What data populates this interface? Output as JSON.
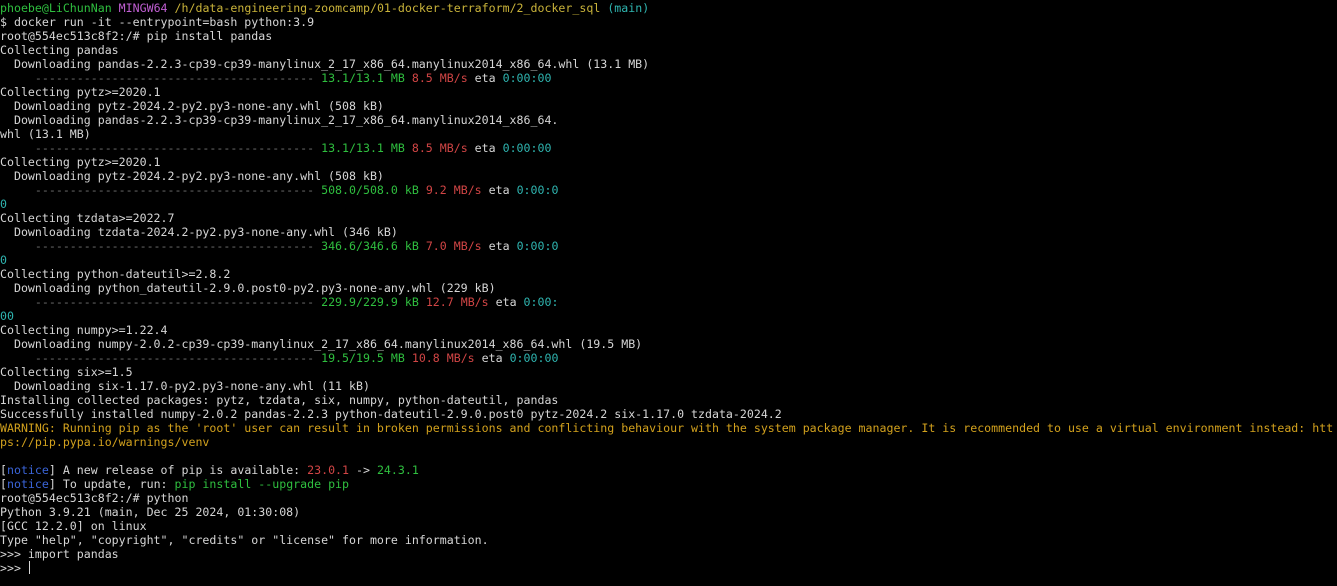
{
  "colors": {
    "default": "#d6d6d6",
    "green": "#2fbf3f",
    "purple": "#c15fd3",
    "yellow": "#c9b33a",
    "cyan": "#2fb5b0",
    "red": "#d14545",
    "bar_gray": "#6f6f6f",
    "blue": "#3a64d8",
    "warning": "#d2a11d"
  },
  "terminal": {
    "lines": [
      [
        {
          "t": "phoebe@LiChunNan",
          "c": "green"
        },
        {
          "t": " ",
          "c": "default"
        },
        {
          "t": "MINGW64",
          "c": "purple"
        },
        {
          "t": " ",
          "c": "default"
        },
        {
          "t": "/h/data-engineering-zoomcamp/01-docker-terraform/2_docker_sql",
          "c": "yellow"
        },
        {
          "t": " ",
          "c": "default"
        },
        {
          "t": "(main)",
          "c": "cyan"
        }
      ],
      [
        {
          "t": "$ docker run -it --entrypoint=bash python:3.9",
          "c": "default"
        }
      ],
      [
        {
          "t": "root@554ec513c8f2:/# pip install pandas",
          "c": "default"
        }
      ],
      [
        {
          "t": "Collecting pandas",
          "c": "default"
        }
      ],
      [
        {
          "t": "  Downloading pandas-2.2.3-cp39-cp39-manylinux_2_17_x86_64.manylinux2014_x86_64.whl (13.1 MB)",
          "c": "default"
        }
      ],
      [
        {
          "t": "     ---------------------------------------- ",
          "c": "bar_gray"
        },
        {
          "t": "13.1/13.1 MB",
          "c": "green"
        },
        {
          "t": " ",
          "c": "default"
        },
        {
          "t": "8.5 MB/s",
          "c": "red"
        },
        {
          "t": " eta ",
          "c": "default"
        },
        {
          "t": "0:00:00",
          "c": "cyan"
        }
      ],
      [
        {
          "t": "Collecting pytz>=2020.1",
          "c": "default"
        }
      ],
      [
        {
          "t": "  Downloading pytz-2024.2-py2.py3-none-any.whl (508 kB)",
          "c": "default"
        }
      ],
      [
        {
          "t": "  Downloading pandas-2.2.3-cp39-cp39-manylinux_2_17_x86_64.manylinux2014_x86_64.",
          "c": "default"
        }
      ],
      [
        {
          "t": "whl (13.1 MB)",
          "c": "default"
        }
      ],
      [
        {
          "t": "     ---------------------------------------- ",
          "c": "bar_gray"
        },
        {
          "t": "13.1/13.1 MB",
          "c": "green"
        },
        {
          "t": " ",
          "c": "default"
        },
        {
          "t": "8.5 MB/s",
          "c": "red"
        },
        {
          "t": " eta ",
          "c": "default"
        },
        {
          "t": "0:00:00",
          "c": "cyan"
        }
      ],
      [
        {
          "t": "Collecting pytz>=2020.1",
          "c": "default"
        }
      ],
      [
        {
          "t": "  Downloading pytz-2024.2-py2.py3-none-any.whl (508 kB)",
          "c": "default"
        }
      ],
      [
        {
          "t": "     ---------------------------------------- ",
          "c": "bar_gray"
        },
        {
          "t": "508.0/508.0 kB",
          "c": "green"
        },
        {
          "t": " ",
          "c": "default"
        },
        {
          "t": "9.2 MB/s",
          "c": "red"
        },
        {
          "t": " eta ",
          "c": "default"
        },
        {
          "t": "0:00:0",
          "c": "cyan"
        }
      ],
      [
        {
          "t": "0",
          "c": "cyan"
        }
      ],
      [
        {
          "t": "Collecting tzdata>=2022.7",
          "c": "default"
        }
      ],
      [
        {
          "t": "  Downloading tzdata-2024.2-py2.py3-none-any.whl (346 kB)",
          "c": "default"
        }
      ],
      [
        {
          "t": "     ---------------------------------------- ",
          "c": "bar_gray"
        },
        {
          "t": "346.6/346.6 kB",
          "c": "green"
        },
        {
          "t": " ",
          "c": "default"
        },
        {
          "t": "7.0 MB/s",
          "c": "red"
        },
        {
          "t": " eta ",
          "c": "default"
        },
        {
          "t": "0:00:0",
          "c": "cyan"
        }
      ],
      [
        {
          "t": "0",
          "c": "cyan"
        }
      ],
      [
        {
          "t": "Collecting python-dateutil>=2.8.2",
          "c": "default"
        }
      ],
      [
        {
          "t": "  Downloading python_dateutil-2.9.0.post0-py2.py3-none-any.whl (229 kB)",
          "c": "default"
        }
      ],
      [
        {
          "t": "     ---------------------------------------- ",
          "c": "bar_gray"
        },
        {
          "t": "229.9/229.9 kB",
          "c": "green"
        },
        {
          "t": " ",
          "c": "default"
        },
        {
          "t": "12.7 MB/s",
          "c": "red"
        },
        {
          "t": " eta ",
          "c": "default"
        },
        {
          "t": "0:00:",
          "c": "cyan"
        }
      ],
      [
        {
          "t": "00",
          "c": "cyan"
        }
      ],
      [
        {
          "t": "Collecting numpy>=1.22.4",
          "c": "default"
        }
      ],
      [
        {
          "t": "  Downloading numpy-2.0.2-cp39-cp39-manylinux_2_17_x86_64.manylinux2014_x86_64.whl (19.5 MB)",
          "c": "default"
        }
      ],
      [
        {
          "t": "     ---------------------------------------- ",
          "c": "bar_gray"
        },
        {
          "t": "19.5/19.5 MB",
          "c": "green"
        },
        {
          "t": " ",
          "c": "default"
        },
        {
          "t": "10.8 MB/s",
          "c": "red"
        },
        {
          "t": " eta ",
          "c": "default"
        },
        {
          "t": "0:00:00",
          "c": "cyan"
        }
      ],
      [
        {
          "t": "Collecting six>=1.5",
          "c": "default"
        }
      ],
      [
        {
          "t": "  Downloading six-1.17.0-py2.py3-none-any.whl (11 kB)",
          "c": "default"
        }
      ],
      [
        {
          "t": "Installing collected packages: pytz, tzdata, six, numpy, python-dateutil, pandas",
          "c": "default"
        }
      ],
      [
        {
          "t": "Successfully installed numpy-2.0.2 pandas-2.2.3 python-dateutil-2.9.0.post0 pytz-2024.2 six-1.17.0 tzdata-2024.2",
          "c": "default"
        }
      ],
      [
        {
          "t": "WARNING: Running pip as the 'root' user can result in broken permissions and conflicting behaviour with the system package manager. It is recommended to use a virtual environment instead: htt",
          "c": "warning"
        }
      ],
      [
        {
          "t": "ps://pip.pypa.io/warnings/venv",
          "c": "warning"
        }
      ],
      [
        {
          "t": "",
          "c": "default"
        }
      ],
      [
        {
          "t": "[",
          "c": "default"
        },
        {
          "t": "notice",
          "c": "blue"
        },
        {
          "t": "] A new release of pip is available: ",
          "c": "default"
        },
        {
          "t": "23.0.1",
          "c": "red"
        },
        {
          "t": " -> ",
          "c": "default"
        },
        {
          "t": "24.3.1",
          "c": "green"
        }
      ],
      [
        {
          "t": "[",
          "c": "default"
        },
        {
          "t": "notice",
          "c": "blue"
        },
        {
          "t": "] To update, run: ",
          "c": "default"
        },
        {
          "t": "pip install --upgrade pip",
          "c": "green"
        }
      ],
      [
        {
          "t": "root@554ec513c8f2:/# python",
          "c": "default"
        }
      ],
      [
        {
          "t": "Python 3.9.21 (main, Dec 25 2024, 01:30:08)",
          "c": "default"
        }
      ],
      [
        {
          "t": "[GCC 12.2.0] on linux",
          "c": "default"
        }
      ],
      [
        {
          "t": "Type \"help\", \"copyright\", \"credits\" or \"license\" for more information.",
          "c": "default"
        }
      ],
      [
        {
          "t": ">>> import pandas",
          "c": "default"
        }
      ],
      [
        {
          "t": ">>> ",
          "c": "default"
        }
      ]
    ]
  }
}
